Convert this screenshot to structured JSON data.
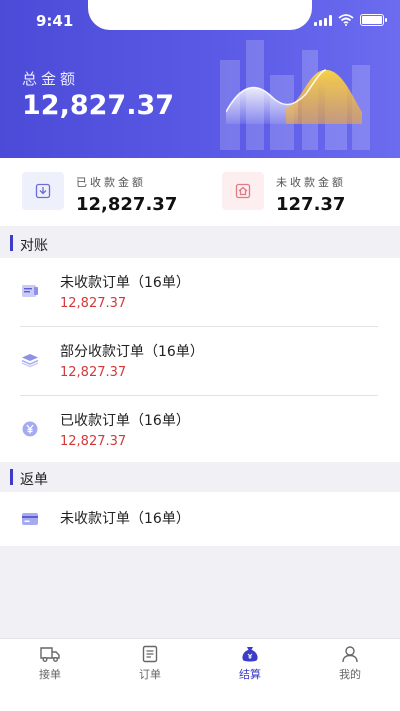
{
  "status": {
    "time": "9:41"
  },
  "header": {
    "total_label": "总金额",
    "total_amount": "12,827.37"
  },
  "summary": {
    "received": {
      "label": "已收款金额",
      "value": "12,827.37"
    },
    "unreceived": {
      "label": "未收款金额",
      "value": "127.37"
    }
  },
  "sections": {
    "reconcile": {
      "title": "对账",
      "items": [
        {
          "name": "未收款订单（16单）",
          "amount": "12,827.37",
          "icon": "invoice-icon"
        },
        {
          "name": "部分收款订单（16单）",
          "amount": "12,827.37",
          "icon": "layers-icon"
        },
        {
          "name": "已收款订单（16单）",
          "amount": "12,827.37",
          "icon": "yen-coin-icon"
        }
      ]
    },
    "rebate": {
      "title": "返单",
      "items": [
        {
          "name": "未收款订单（16单）",
          "icon": "card-icon"
        }
      ]
    }
  },
  "tabs": [
    {
      "label": "接单",
      "icon": "truck-icon",
      "active": false
    },
    {
      "label": "订单",
      "icon": "document-icon",
      "active": false
    },
    {
      "label": "结算",
      "icon": "money-bag-icon",
      "active": true
    },
    {
      "label": "我的",
      "icon": "user-icon",
      "active": false
    }
  ],
  "colors": {
    "primary": "#4b4bd8",
    "amount_red": "#d23a3a",
    "accent_yellow": "#f5c542"
  }
}
